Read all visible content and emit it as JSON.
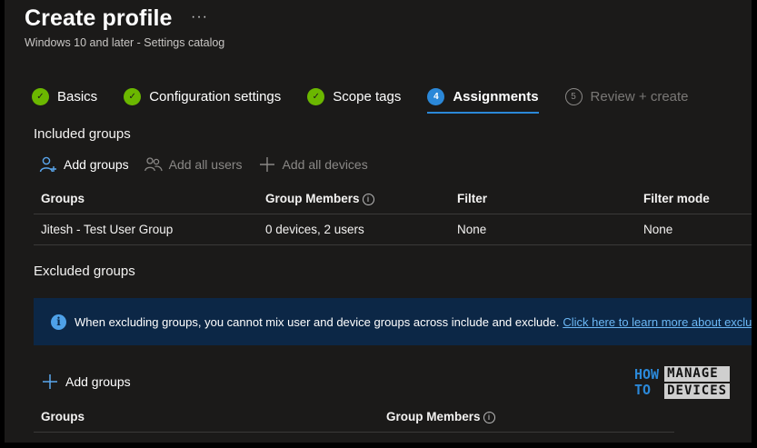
{
  "header": {
    "title": "Create profile",
    "more": "···",
    "subtitle": "Windows 10 and later - Settings catalog"
  },
  "steps": [
    {
      "label": "Basics",
      "state": "done",
      "marker": "✓"
    },
    {
      "label": "Configuration settings",
      "state": "done",
      "marker": "✓"
    },
    {
      "label": "Scope tags",
      "state": "done",
      "marker": "✓"
    },
    {
      "label": "Assignments",
      "state": "current",
      "marker": "4"
    },
    {
      "label": "Review + create",
      "state": "future",
      "marker": "5"
    }
  ],
  "included": {
    "title": "Included groups",
    "actions": {
      "add_groups": "Add groups",
      "add_all_users": "Add all users",
      "add_all_devices": "Add all devices"
    },
    "columns": {
      "groups": "Groups",
      "members": "Group Members",
      "filter": "Filter",
      "filter_mode": "Filter mode"
    },
    "rows": [
      {
        "group": "Jitesh - Test User Group",
        "members": "0 devices, 2 users",
        "filter": "None",
        "filter_mode": "None"
      }
    ]
  },
  "excluded": {
    "title": "Excluded groups",
    "info_text": "When excluding groups, you cannot mix user and device groups across include and exclude.",
    "info_link": "Click here to learn more about excluding.",
    "add_groups": "Add groups",
    "columns": {
      "groups": "Groups",
      "members": "Group Members"
    }
  },
  "logo": {
    "line1_left": "HOW",
    "line2_left": "TO",
    "line1_right": "MANAGE",
    "line2_right": "DEVICES"
  },
  "colors": {
    "done": "#6bb700",
    "current": "#2b88d8",
    "link": "#6cb8f6",
    "banner": "#0c2746"
  }
}
